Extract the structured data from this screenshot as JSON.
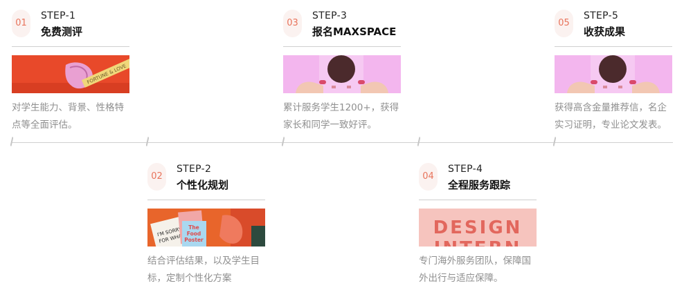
{
  "steps": [
    {
      "num": "01",
      "code": "STEP-1",
      "title": "免费测评",
      "desc": "对学生能力、背景、性格特点等全面评估。",
      "image": "fortune-cookie-photo"
    },
    {
      "num": "02",
      "code": "STEP-2",
      "title": "个性化规划",
      "desc": "结合评估结果，以及学生目标，定制个性化方案",
      "image": "food-poster-cards-photo"
    },
    {
      "num": "03",
      "code": "STEP-3",
      "title": "报名MAXSPACE",
      "desc": "累计服务学生1200+，获得家长和同学一致好评。",
      "image": "hands-holding-record-photo"
    },
    {
      "num": "04",
      "code": "STEP-4",
      "title": "全程服务跟踪",
      "desc": "专门海外服务团队，保障国外出行与适应保障。",
      "image": "design-letters-photo"
    },
    {
      "num": "05",
      "code": "STEP-5",
      "title": "收获成果",
      "desc": "获得高含金量推荐信，名企实习证明，专业论文发表。",
      "image": "hands-holding-record-photo"
    }
  ],
  "thumb_text": {
    "fortune": "FORTUNE & LOVE",
    "poster": [
      "The",
      "Food",
      "Poster"
    ],
    "card": [
      "I'M SORRY",
      "FOR WHAT"
    ],
    "design": [
      "DESIGN",
      "INTERN"
    ]
  },
  "colors": {
    "accent": "#e8735b",
    "badge_bg": "#fbf2f0",
    "line": "#cfcfcf",
    "desc": "#8f8f8f"
  }
}
